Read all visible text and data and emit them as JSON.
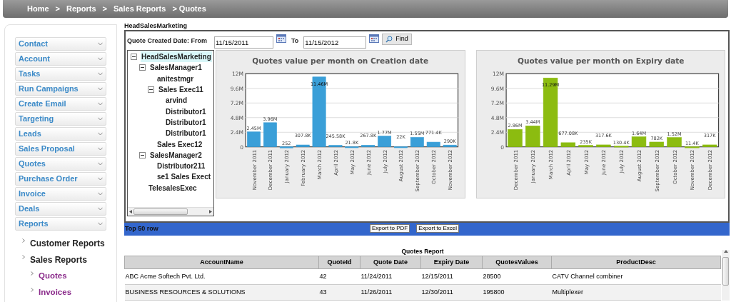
{
  "breadcrumb": [
    "Home",
    ">",
    "Reports",
    ">",
    "Sales Reports",
    "> Quotes"
  ],
  "sidebar": {
    "menu": [
      "Contact",
      "Account",
      "Tasks",
      "Run Campaigns",
      "Create Email",
      "Targeting",
      "Leads",
      "Sales Proposal",
      "Quotes",
      "Purchase Order",
      "Invoice",
      "Deals",
      "Reports"
    ],
    "links": [
      {
        "label": "Customer Reports"
      },
      {
        "label": "Sales Reports",
        "children": [
          {
            "label": "Quotes"
          },
          {
            "label": "Invoices"
          }
        ]
      }
    ]
  },
  "page_title": "HeadSalesMarketing",
  "filter": {
    "label": "Quote Created Date:  From",
    "from": "11/15/2011",
    "to_label": "To",
    "to": "11/15/2012",
    "find": "Find"
  },
  "tree": [
    {
      "label": "HeadSalesMarketing",
      "selected": true,
      "expanded": true,
      "children": [
        {
          "label": "SalesManager1",
          "selected": false,
          "expanded": true,
          "children": [
            {
              "label": "anitestmgr",
              "selected": false
            },
            {
              "label": "Sales Exec11",
              "selected": false,
              "expanded": true,
              "children": [
                {
                  "label": "arvind",
                  "selected": false
                },
                {
                  "label": "Distributor1",
                  "selected": false
                },
                {
                  "label": "Distributor1",
                  "selected": false
                },
                {
                  "label": "Distributor1",
                  "selected": false
                }
              ]
            },
            {
              "label": "Sales Exec12",
              "selected": false
            }
          ]
        },
        {
          "label": "SalesManager2",
          "selected": false,
          "expanded": true,
          "children": [
            {
              "label": "Distributor211",
              "selected": false
            },
            {
              "label": "se1 Sales Exect",
              "selected": false
            }
          ]
        },
        {
          "label": "TelesalesExec",
          "selected": false
        }
      ]
    }
  ],
  "charts": [
    {
      "chart_data": {
        "type": "bar",
        "title": "Quotes value per month on Creation date",
        "categories": [
          "November 2011",
          "December 2011",
          "January 2012",
          "February 2012",
          "March 2012",
          "April 2012",
          "May 2012",
          "June 2012",
          "July 2012",
          "August 2012",
          "September 2012",
          "October 2012",
          "November 2012"
        ],
        "series": [
          {
            "color": "#3a9fd8",
            "values": [
              2450000,
              3960000,
              252,
              307800,
              11460000,
              245580,
              21800,
              267800,
              1770000,
              22000,
              1550000,
              771400,
              290000
            ]
          }
        ],
        "grid": true,
        "value_labels": [
          "2.45M",
          "3.96M",
          "252",
          "307.8K",
          "11.46M",
          "245.58K",
          "21.8K",
          "267.8K",
          "1.77M",
          "22K",
          "1.55M",
          "771.4K",
          "290K"
        ],
        "ylim": [
          0,
          12000000
        ],
        "yticks": [
          {
            "value": 0,
            "label": "0"
          },
          {
            "value": 2400000,
            "label": "2.4M"
          },
          {
            "value": 4800000,
            "label": "4.8M"
          },
          {
            "value": 7200000,
            "label": "7.2M"
          },
          {
            "value": 9600000,
            "label": "9.6M"
          },
          {
            "value": 12000000,
            "label": "12M"
          }
        ]
      }
    },
    {
      "chart_data": {
        "type": "bar",
        "title": "Quotes value per month on Expiry date",
        "categories": [
          "December 2011",
          "January 2012",
          "March 2012",
          "April 2012",
          "May 2012",
          "June 2012",
          "July 2012",
          "August 2012",
          "September 2012",
          "October 2012",
          "November 2012",
          "December 2012"
        ],
        "series": [
          {
            "color": "#8cbc10",
            "values": [
              2860000,
              3440000,
              11290000,
              677080,
              235000,
              317600,
              130400,
              1640000,
              782000,
              1520000,
              11400,
              317000
            ]
          }
        ],
        "grid": true,
        "value_labels": [
          "2.86M",
          "3.44M",
          "11.29M",
          "677.08K",
          "235K",
          "317.6K",
          "130.4K",
          "1.64M",
          "782K",
          "1.52M",
          "11.4K",
          "317K"
        ],
        "ylim": [
          0,
          12000000
        ],
        "yticks": [
          {
            "value": 0,
            "label": "0"
          },
          {
            "value": 2400000,
            "label": "2.4M"
          },
          {
            "value": 4800000,
            "label": "4.8M"
          },
          {
            "value": 7200000,
            "label": "7.2M"
          },
          {
            "value": 9600000,
            "label": "9.6M"
          },
          {
            "value": 12000000,
            "label": "12M"
          }
        ]
      }
    }
  ],
  "toolbar": {
    "label": "Top 50 row",
    "buttons": [
      "Export to PDF",
      "Export to Excel"
    ]
  },
  "table": {
    "title": "Quotes Report",
    "columns": [
      "AccountName",
      "QuoteId",
      "Quote Date",
      "Expiry Date",
      "QuotesValues",
      "ProductDesc"
    ],
    "rows": [
      [
        "ABC Acme Softech Pvt. Ltd.",
        "42",
        "11/24/2011",
        "12/15/2011",
        "28500",
        "CATV Channel combiner"
      ],
      [
        "BUSINESS RESOURCES & SOLUTIONS",
        "43",
        "11/26/2011",
        "12/30/2011",
        "195800",
        "Multiplexer"
      ]
    ]
  }
}
